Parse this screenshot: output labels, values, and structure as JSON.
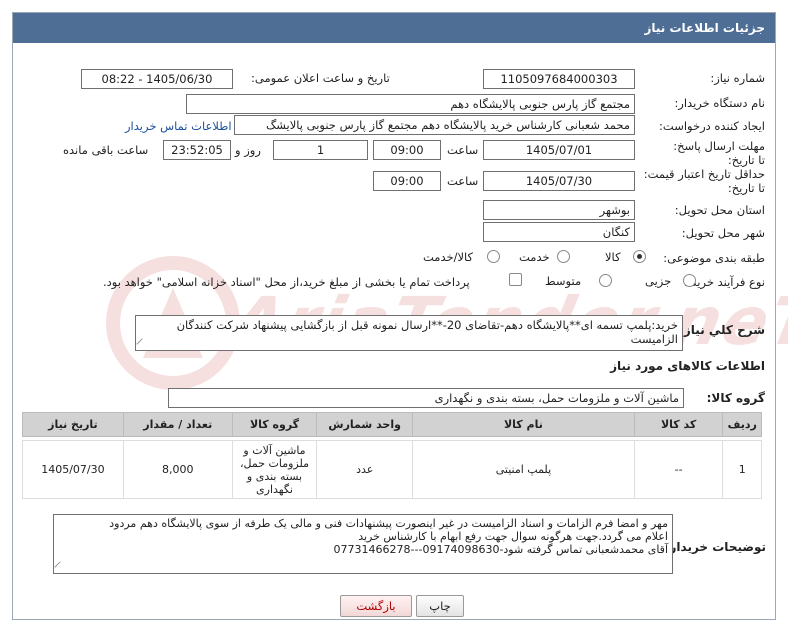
{
  "header": {
    "title": "جزئیات اطلاعات نیاز"
  },
  "fields": {
    "need_number_label": "شماره نیاز:",
    "need_number": "1105097684000303",
    "announce_label": "تاریخ و ساعت اعلان عمومی:",
    "announce_value": "1405/06/30 - 08:22",
    "buyer_org_label": "نام دستگاه خریدار:",
    "buyer_org": "مجتمع گاز پارس جنوبی  پالایشگاه دهم",
    "creator_label": "ایجاد کننده درخواست:",
    "creator": "محمد شعبانی کارشناس خرید پالایشگاه دهم  مجتمع گاز پارس جنوبی  پالایشگ",
    "contact_link": "اطلاعات تماس خریدار",
    "deadline_label": "مهلت ارسال پاسخ: تا تاریخ:",
    "deadline_date": "1405/07/01",
    "time_label": "ساعت",
    "deadline_time": "09:00",
    "days_value": "1",
    "days_label": "روز و",
    "remaining_time": "23:52:05",
    "remaining_label": "ساعت باقی مانده",
    "validity_label": "حداقل تاریخ اعتبار قیمت: تا تاریخ:",
    "validity_date": "1405/07/30",
    "validity_time": "09:00",
    "province_label": "استان محل تحویل:",
    "province": "بوشهر",
    "city_label": "شهر محل تحویل:",
    "city": "کنگان",
    "category_label": "طبقه بندی موضوعی:",
    "category_options": [
      "کالا",
      "خدمت",
      "کالا/خدمت"
    ],
    "process_label": "نوع فرآیند خرید :",
    "process_options": [
      "جزیی",
      "متوسط"
    ],
    "payment_note": "پرداخت تمام یا بخشی از مبلغ خرید،از محل \"اسناد خزانه اسلامی\" خواهد بود."
  },
  "description": {
    "label": "شرح کلي نياز:",
    "text": "خرید:پلمپ تسمه ای**پالایشگاه دهم-تقاضای 20-**ارسال نمونه قبل از بازگشایی پیشنهاد شرکت کنندگان الزامیست"
  },
  "goods": {
    "title": "اطلاعات کالاهای مورد نیاز",
    "group_label": "گروه کالا:",
    "group_value": "ماشین آلات و ملزومات حمل، بسته بندی و نگهداری"
  },
  "table": {
    "headers": [
      "ردیف",
      "کد کالا",
      "نام کالا",
      "واحد شمارش",
      "گروه کالا",
      "تعداد / مقدار",
      "تاریخ نیاز"
    ],
    "rows": [
      [
        "1",
        "--",
        "پلمپ امنیتی",
        "عدد",
        "ماشین آلات و ملزومات حمل، بسته بندی و نگهداری",
        "8,000",
        "1405/07/30"
      ]
    ]
  },
  "buyer_notes": {
    "label": "توضیحات خریدار:",
    "lines": [
      "مهر و امضا فرم الزامات و اسناد الزامیست در غیر اینصورت پیشنهادات فنی و مالی یک طرفه از سوی پالایشگاه دهم مردود",
      "اعلام می گردد.جهت هرگونه سوال جهت رفع ابهام با کارشناس خرید",
      "آقای محمدشعبانی تماس گرفته شود-09174098630---07731466278"
    ]
  },
  "buttons": {
    "print": "چاپ",
    "back": "بازگشت"
  },
  "watermark": "AriaTender.neT"
}
